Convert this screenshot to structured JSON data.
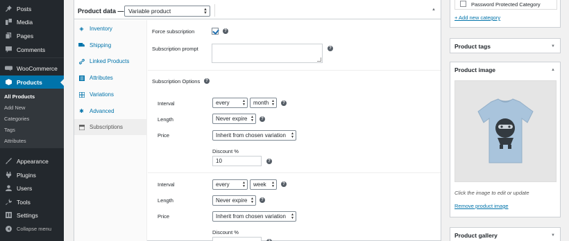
{
  "admin_menu": {
    "items": [
      {
        "label": "Posts",
        "icon": "pushpin-icon"
      },
      {
        "label": "Media",
        "icon": "media-icon"
      },
      {
        "label": "Pages",
        "icon": "pages-icon"
      },
      {
        "label": "Comments",
        "icon": "comments-icon"
      },
      {
        "label": "WooCommerce",
        "icon": "woocommerce-icon"
      },
      {
        "label": "Products",
        "icon": "products-icon"
      },
      {
        "label": "Appearance",
        "icon": "paintbrush-icon"
      },
      {
        "label": "Plugins",
        "icon": "plugins-icon"
      },
      {
        "label": "Users",
        "icon": "users-icon"
      },
      {
        "label": "Tools",
        "icon": "wrench-icon"
      },
      {
        "label": "Settings",
        "icon": "settings-icon"
      },
      {
        "label": "Collapse menu",
        "icon": "collapse-icon"
      }
    ],
    "products_submenu": [
      "All Products",
      "Add New",
      "Categories",
      "Tags",
      "Attributes"
    ]
  },
  "product_data": {
    "title": "Product data —",
    "type_select": "Variable product",
    "tabs": [
      {
        "label": "Inventory",
        "icon": "diamond-icon"
      },
      {
        "label": "Shipping",
        "icon": "truck-icon"
      },
      {
        "label": "Linked Products",
        "icon": "link-icon"
      },
      {
        "label": "Attributes",
        "icon": "list-icon"
      },
      {
        "label": "Variations",
        "icon": "grid-icon"
      },
      {
        "label": "Advanced",
        "icon": "gear-icon"
      },
      {
        "label": "Subscriptions",
        "icon": "calendar-icon"
      }
    ],
    "force_subscription_label": "Force subscription",
    "force_subscription_checked": true,
    "subscription_prompt_label": "Subscription prompt",
    "subscription_options_label": "Subscription Options",
    "option_groups": [
      {
        "interval_label": "Interval",
        "interval_every": "every",
        "interval_period": "month",
        "length_label": "Length",
        "length_value": "Never expire",
        "price_label": "Price",
        "price_value": "Inherit from chosen variation",
        "discount_label": "Discount %",
        "discount_value": "10"
      },
      {
        "interval_label": "Interval",
        "interval_every": "every",
        "interval_period": "week",
        "length_label": "Length",
        "length_value": "Never expire",
        "price_label": "Price",
        "price_value": "Inherit from chosen variation",
        "discount_label": "Discount %",
        "discount_value": ""
      }
    ]
  },
  "sidebar": {
    "category": "Password Protected Category",
    "add_category": "+ Add new category",
    "product_tags": "Product tags",
    "product_image": "Product image",
    "image_caption": "Click the image to edit or update",
    "remove_image": "Remove product image",
    "product_gallery": "Product gallery"
  },
  "colors": {
    "menu_bg": "#23282d",
    "accent": "#0073aa"
  }
}
